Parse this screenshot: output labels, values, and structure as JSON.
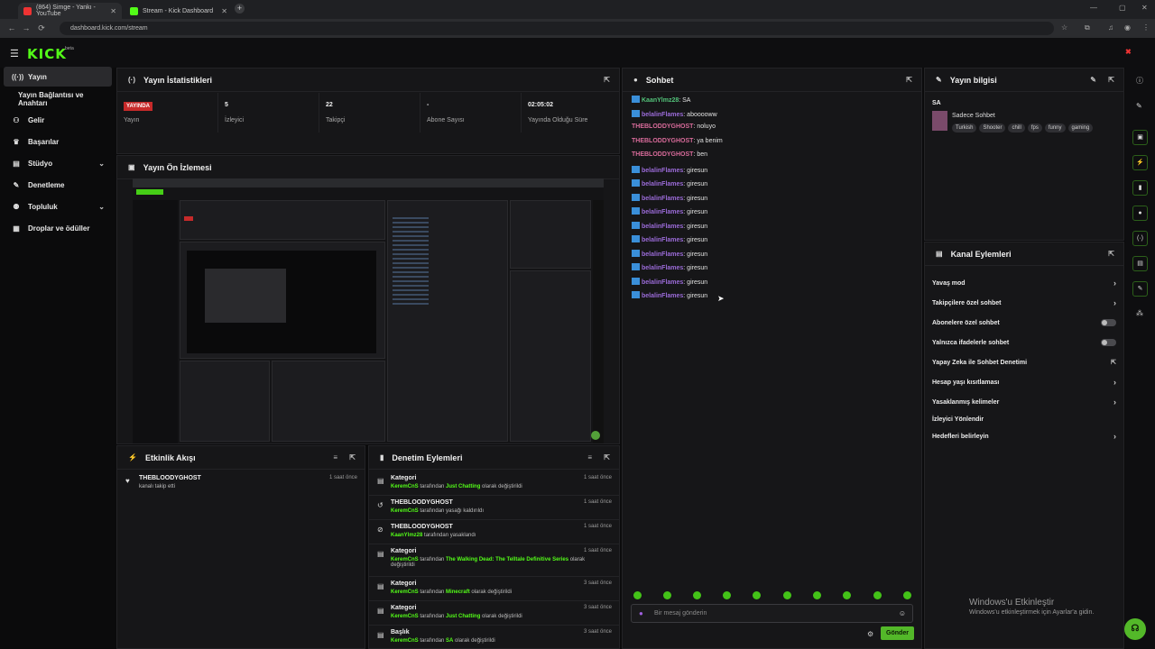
{
  "browser": {
    "tabs": [
      {
        "title": "(864) Simge - Yankı - YouTube",
        "color": "#e33"
      },
      {
        "title": "Stream - Kick Dashboard",
        "color": "#53fc18"
      }
    ],
    "url": "dashboard.kick.com/stream"
  },
  "app": {
    "logo": "KICK",
    "logo_sup": "beta",
    "accent": "#53fc18"
  },
  "sidebar": {
    "items": [
      {
        "label": "Yayın",
        "icon": "broadcast-icon"
      },
      {
        "label": "Yayın Bağlantısı ve Anahtarı",
        "icon": ""
      },
      {
        "label": "Gelir",
        "icon": "money-icon"
      },
      {
        "label": "Başarılar",
        "icon": "trophy-icon"
      },
      {
        "label": "Stüdyo",
        "icon": "layers-icon"
      },
      {
        "label": "Denetleme",
        "icon": "wrench-icon"
      },
      {
        "label": "Topluluk",
        "icon": "people-icon"
      },
      {
        "label": "Droplar ve ödüller",
        "icon": "gift-icon"
      }
    ]
  },
  "stats": {
    "title": "Yayın İstatistikleri",
    "live_badge": "YAYINDA",
    "items": [
      {
        "value": "",
        "label": "Yayın"
      },
      {
        "value": "5",
        "label": "İzleyici"
      },
      {
        "value": "22",
        "label": "Takipçi"
      },
      {
        "value": "-",
        "label": "Abone Sayısı"
      },
      {
        "value": "02:05:02",
        "label": "Yayında Olduğu Süre"
      }
    ]
  },
  "preview": {
    "title": "Yayın Ön İzlemesi"
  },
  "activity": {
    "title": "Etkinlik Akışı",
    "items": [
      {
        "user": "THEBLOODYGHOST",
        "desc": "kanalı takip etti",
        "time": "1 saat önce"
      }
    ]
  },
  "moderation": {
    "title": "Denetim Eylemleri",
    "items": [
      {
        "title": "Kategori",
        "pre": "",
        "user": "KeremCnS",
        "mid": " tarafından ",
        "target": "Just Chatting",
        "post": " olarak değiştirildi",
        "time": "1 saat önce"
      },
      {
        "title": "THEBLOODYGHOST",
        "pre": "",
        "user": "KeremCnS",
        "mid": " tarafından yasağı kaldırıldı",
        "target": "",
        "post": "",
        "time": "1 saat önce"
      },
      {
        "title": "THEBLOODYGHOST",
        "pre": "",
        "user": "KaanYlmz28",
        "mid": " tarafından yasaklandı",
        "target": "",
        "post": "",
        "time": "1 saat önce"
      },
      {
        "title": "Kategori",
        "pre": "",
        "user": "KeremCnS",
        "mid": " tarafından ",
        "target": "The Walking Dead: The Telltale Definitive Series",
        "post": " olarak değiştirildi",
        "time": "1 saat önce"
      },
      {
        "title": "Kategori",
        "pre": "",
        "user": "KeremCnS",
        "mid": " tarafından ",
        "target": "Minecraft",
        "post": " olarak değiştirildi",
        "time": "3 saat önce"
      },
      {
        "title": "Kategori",
        "pre": "",
        "user": "KeremCnS",
        "mid": " tarafından ",
        "target": "Just Chatting",
        "post": " olarak değiştirildi",
        "time": "3 saat önce"
      },
      {
        "title": "Başlık",
        "pre": "",
        "user": "KeremCnS",
        "mid": " tarafından ",
        "target": "SA",
        "post": " olarak değiştirildi",
        "time": "3 saat önce"
      }
    ]
  },
  "chat": {
    "title": "Sohbet",
    "messages": [
      {
        "user": "KaanYlmz28",
        "color": "green",
        "text": ": SA",
        "badge": true
      },
      {
        "user": "belalinFlames",
        "color": "purple",
        "text": ": abooooww",
        "badge": true
      },
      {
        "user": "THEBLODDYGHOST",
        "color": "pink",
        "text": ": noluyo",
        "badge": false
      },
      {
        "user": "THEBLODDYGHOST",
        "color": "pink",
        "text": ": ya benim",
        "badge": false
      },
      {
        "user": "THEBLODDYGHOST",
        "color": "pink",
        "text": ": ben",
        "badge": false
      },
      {
        "user": "belalinFlames",
        "color": "purple",
        "text": ": giresun",
        "badge": true
      },
      {
        "user": "belalinFlames",
        "color": "purple",
        "text": ": giresun",
        "badge": true
      },
      {
        "user": "belalinFlames",
        "color": "purple",
        "text": ": giresun",
        "badge": true
      },
      {
        "user": "belalinFlames",
        "color": "purple",
        "text": ": giresun",
        "badge": true
      },
      {
        "user": "belalinFlames",
        "color": "purple",
        "text": ": giresun",
        "badge": true
      },
      {
        "user": "belalinFlames",
        "color": "purple",
        "text": ": giresun",
        "badge": true
      },
      {
        "user": "belalinFlames",
        "color": "purple",
        "text": ": giresun",
        "badge": true
      },
      {
        "user": "belalinFlames",
        "color": "purple",
        "text": ": giresun",
        "badge": true
      },
      {
        "user": "belalinFlames",
        "color": "purple",
        "text": ": giresun",
        "badge": true
      },
      {
        "user": "belalinFlames",
        "color": "purple",
        "text": ": giresun",
        "badge": true
      }
    ],
    "input_placeholder": "Bir mesaj gönderin",
    "send_label": "Gönder"
  },
  "stream_info": {
    "title": "Yayın bilgisi",
    "stream_title": "SA",
    "category": "Sadece Sohbet",
    "tags": [
      "Turkish",
      "Shooter",
      "chill",
      "fps",
      "funny",
      "gaming"
    ]
  },
  "channel_actions": {
    "title": "Kanal Eylemleri",
    "items": [
      {
        "label": "Yavaş mod",
        "control": "chevron"
      },
      {
        "label": "Takipçilere özel sohbet",
        "control": "chevron"
      },
      {
        "label": "Abonelere özel sohbet",
        "control": "toggle"
      },
      {
        "label": "Yalnızca ifadelerle sohbet",
        "control": "toggle"
      },
      {
        "label": "Yapay Zeka ile Sohbet Denetimi",
        "control": "external"
      },
      {
        "label": "Hesap yaşı kısıtlaması",
        "control": "chevron"
      },
      {
        "label": "Yasaklanmış kelimeler",
        "control": "chevron"
      },
      {
        "label": "İzleyici Yönlendir",
        "control": "none"
      },
      {
        "label": "Hedefleri belirleyin",
        "control": "chevron"
      }
    ]
  },
  "windows_watermark": {
    "title": "Windows'u Etkinleştir",
    "subtitle": "Windows'u etkinleştirmek için Ayarlar'a gidin."
  }
}
